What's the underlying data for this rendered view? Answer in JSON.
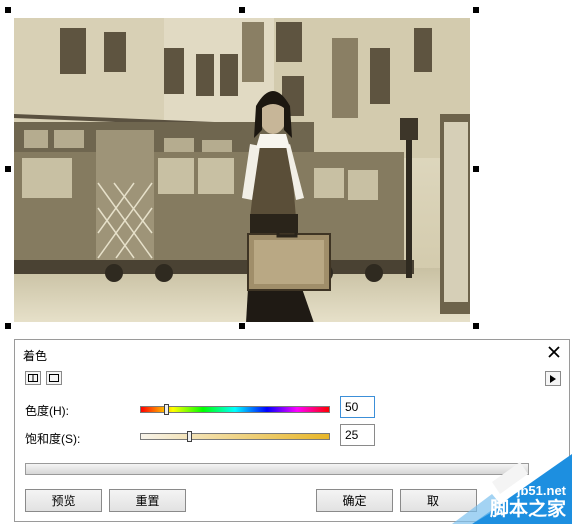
{
  "dialog": {
    "title": "着色",
    "hue": {
      "label": "色度(H):",
      "value": "50",
      "fraction": 0.13
    },
    "saturation": {
      "label": "饱和度(S):",
      "value": "25",
      "fraction": 0.25
    },
    "buttons": {
      "preview": "预览",
      "reset": "重置",
      "ok": "确定",
      "cancel": "取"
    }
  },
  "watermark": {
    "url": "jb51.net",
    "brand": "脚本之家"
  },
  "icons": {
    "close": "close-icon",
    "view_split": "split-view-icon",
    "view_single": "single-view-icon",
    "play": "play-icon"
  },
  "colors": {
    "photo_tint": "#cfc6a6",
    "focus_border": "#3c8fd8",
    "watermark_blue": "#1d8fe0"
  }
}
